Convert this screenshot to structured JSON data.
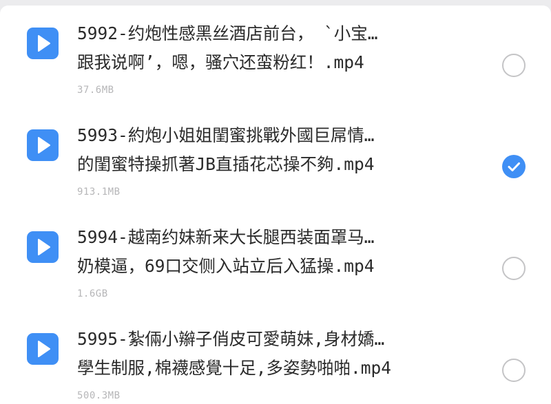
{
  "files": [
    {
      "name_line1": "5992-约炮性感黑丝酒店前台，  `小宝…",
      "name_line2": "跟我说啊’，嗯，骚穴还蛮粉红！.mp4",
      "size": "37.6MB",
      "selected": false,
      "type_icon": "video-play-icon"
    },
    {
      "name_line1": "5993-約炮小姐姐閨蜜挑戰外國巨屌情…",
      "name_line2": "的閨蜜特操抓著JB直插花芯操不夠.mp4",
      "size": "913.1MB",
      "selected": true,
      "type_icon": "video-play-icon"
    },
    {
      "name_line1": "5994-越南约妹新来大长腿西装面罩马…",
      "name_line2": "奶模逼，69口交侧入站立后入猛操.mp4",
      "size": "1.6GB",
      "selected": false,
      "type_icon": "video-play-icon"
    },
    {
      "name_line1": "5995-紮倆小辮子俏皮可愛萌妹,身材嬌…",
      "name_line2": "學生制服,棉襪感覺十足,多姿勢啪啪.mp4",
      "size": "500.3MB",
      "selected": false,
      "type_icon": "video-play-icon"
    }
  ],
  "colors": {
    "accent": "#3f8ff5",
    "text_primary": "#2a2a2a",
    "text_secondary": "#b6b6b8",
    "circle_border": "#c4c4c6",
    "background": "#ffffff",
    "backdrop": "#ececee"
  }
}
